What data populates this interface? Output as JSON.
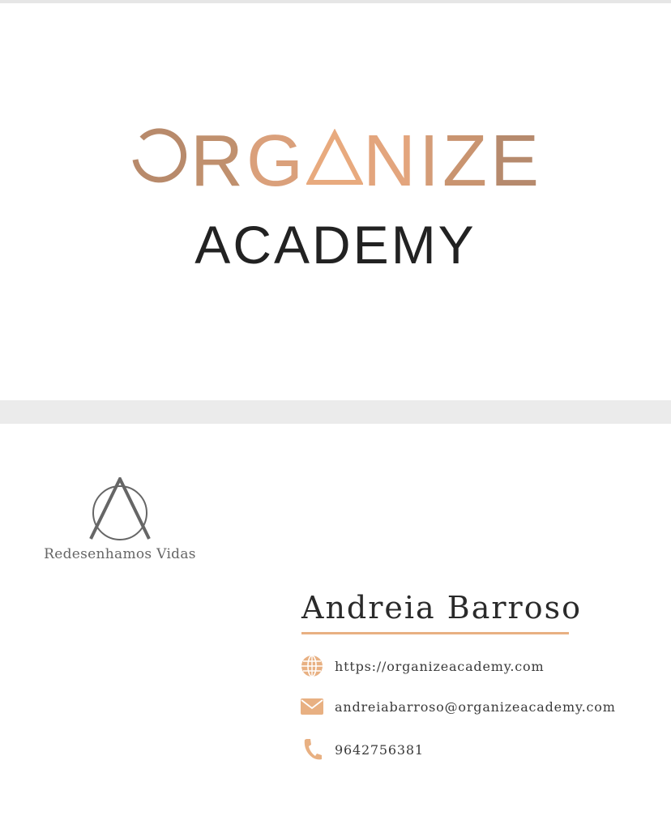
{
  "front": {
    "logo_word": [
      "O",
      "R",
      "G",
      "A",
      "N",
      "I",
      "Z",
      "E"
    ],
    "logo_sub": "ACADEMY"
  },
  "back": {
    "tagline": "Redesenhamos Vidas",
    "name": "Andreia Barroso",
    "contacts": [
      {
        "icon": "globe-icon",
        "text": "https://organizeacademy.com"
      },
      {
        "icon": "envelope-icon",
        "text": "andreiabarroso@organizeacademy.com"
      },
      {
        "icon": "phone-icon",
        "text": "9642756381"
      }
    ]
  },
  "colors": {
    "accent": "#e8b082",
    "bronze_dark": "#b88a6b",
    "bronze_light": "#eaa97f",
    "text_dark": "#222222",
    "gray": "#666666",
    "separator": "#ebebeb"
  }
}
